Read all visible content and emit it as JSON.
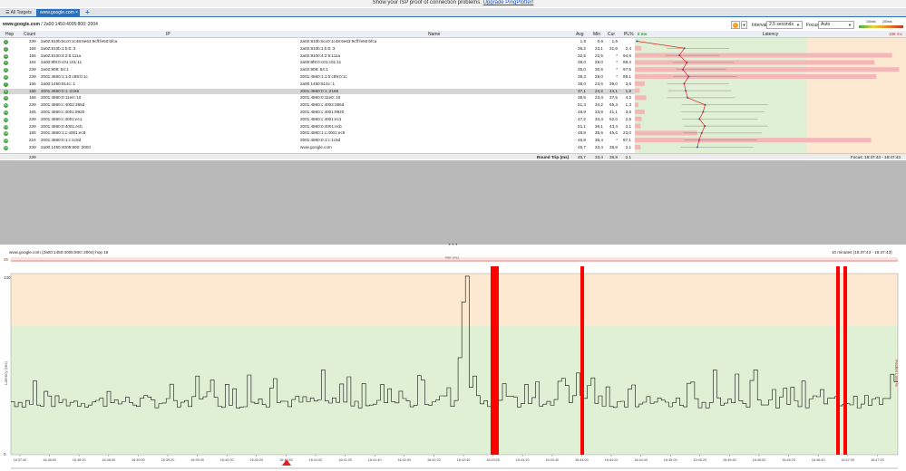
{
  "banner": {
    "text": "Show your ISP proof of connection problems.",
    "link": "Upgrade PingPlotter!"
  },
  "tabs": [
    {
      "label": "All Targets"
    },
    {
      "label": "www.google.com"
    }
  ],
  "tab_add": "+",
  "target": {
    "host": "www.google.com",
    "address": "2a00:1450:4005:800::2004"
  },
  "controls": {
    "interval_label": "Interval",
    "interval_value": "2.5 seconds",
    "focus_label": "Focus",
    "focus_value": "Auto",
    "scale_100": "100ms",
    "scale_200": "200ms"
  },
  "table": {
    "headers": {
      "hop": "Hop",
      "count": "Count",
      "ip": "IP",
      "name": "Name",
      "avg": "Avg",
      "min": "Min",
      "cur": "Cur",
      "pl": "PL%",
      "latency": "Latency"
    },
    "latency_min": "0 ms",
    "latency_max": "198 ms",
    "rows": [
      {
        "hop": "1",
        "count": "239",
        "ip": "2a02:810b:5cc0:1c48:6e63:9cff:fe50:bfca",
        "name": "2a02:810b:5cc0:1c48:6e63:9cff:fe50:bfca",
        "avg": "1,6",
        "min": "0,6",
        "cur": "1,5",
        "pl": ""
      },
      {
        "hop": "2",
        "count": "166",
        "ip": "2a02:810b:1:b:0::3",
        "name": "2a02:810b:1:b:0::3",
        "avg": "36,2",
        "min": "23,1",
        "cur": "31,8",
        "pl": "2,4"
      },
      {
        "hop": "3",
        "count": "156",
        "ip": "2a02:8100:4:2:6:111a",
        "name": "2a02:8100:4:2:6:111a",
        "avg": "32,5",
        "min": "22,5",
        "cur": "*",
        "pl": "94,9"
      },
      {
        "hop": "4",
        "count": "164",
        "ip": "2a00:8f8:0:c01:c01:11",
        "name": "2a00:8f8:0:c01:c01:11",
        "avg": "38,0",
        "min": "28,0",
        "cur": "*",
        "pl": "88,4"
      },
      {
        "hop": "5",
        "count": "239",
        "ip": "2a02:908::54:1",
        "name": "2a02:908::54:1",
        "avg": "35,0",
        "min": "30,5",
        "cur": "*",
        "pl": "97,5"
      },
      {
        "hop": "6",
        "count": "239",
        "ip": "2001:4860:1:1:0:c89:0:1c",
        "name": "2001:4860:1:1:0:c89:0:1c",
        "avg": "39,3",
        "min": "28,0",
        "cur": "*",
        "pl": "89,1"
      },
      {
        "hop": "7",
        "count": "166",
        "ip": "2a00:1450:814c::1",
        "name": "2a00:1450:814c::1",
        "avg": "36,0",
        "min": "23,5",
        "cur": "39,0",
        "pl": "3,6"
      },
      {
        "hop": "8",
        "count": "166",
        "ip": "2001:4860:0:1::2166",
        "name": "2001:4860:0:1::2166",
        "avg": "37,1",
        "min": "24,2",
        "cur": "44,1",
        "pl": "1,8"
      },
      {
        "hop": "9",
        "count": "166",
        "ip": "2001:4860:0:11e0::10",
        "name": "2001:4860:0:11e0::10",
        "avg": "38,5",
        "min": "23,4",
        "cur": "37,5",
        "pl": "4,2"
      },
      {
        "hop": "10",
        "count": "239",
        "ip": "2001:4860:c:4002:365d",
        "name": "2001:4860:c:4002:365d",
        "avg": "51,3",
        "min": "34,2",
        "cur": "65,3",
        "pl": "1,3"
      },
      {
        "hop": "11",
        "count": "165",
        "ip": "2001:4860:c:4001:9920",
        "name": "2001:4860:c:4001:9920",
        "avg": "49,9",
        "min": "33,9",
        "cur": "41,1",
        "pl": "3,6"
      },
      {
        "hop": "12",
        "count": "239",
        "ip": "2001:4860:c:4001:ec1",
        "name": "2001:4860:c:4001:ec1",
        "avg": "47,2",
        "min": "34,4",
        "cur": "52,0",
        "pl": "2,5"
      },
      {
        "hop": "13",
        "count": "239",
        "ip": "2001:4860:0:4001:ecb",
        "name": "2001:4860:0:4001:ecb",
        "avg": "51,1",
        "min": "36,1",
        "cur": "43,4",
        "pl": "2,1"
      },
      {
        "hop": "14",
        "count": "165",
        "ip": "2001:4860:1:c:4001:ec9",
        "name": "2001:4860:1:c:4001:ec9",
        "avg": "48,8",
        "min": "35,6",
        "cur": "45,6",
        "pl": "23,0"
      },
      {
        "hop": "15",
        "count": "224",
        "ip": "2001:4860:0:1:c:1c5d",
        "name": "2001:4860:0:1:c:1c5d",
        "avg": "46,9",
        "min": "36,4",
        "cur": "*",
        "pl": "87,1"
      },
      {
        "hop": "16",
        "count": "239",
        "ip": "2a00:1450:4005:800::2004",
        "name": "www.google.com",
        "avg": "45,7",
        "min": "33,4",
        "cur": "36,8",
        "pl": "2,1"
      }
    ],
    "footer": {
      "count": "239",
      "label": "Round Trip (ms)",
      "avg": "45,7",
      "min": "33,4",
      "cur": "36,8",
      "pl": "2,1",
      "focus": "Focus: 16:37:43 - 16:47:43"
    }
  },
  "splitter": "• • •",
  "bottom": {
    "title": "www.google.com (2a00:1450:4005:800::2004) hop 16",
    "range": "10 minutes (16:37:43 - 16:47:43)",
    "pl_value": "35",
    "y_top": "140",
    "y_zero": "0",
    "ylabel": "Latency (ms)",
    "ylabel_right": "Packet Loss %",
    "jitter_label": "Jitter (ms)",
    "xticks": [
      "16:37:40",
      "16:38:00",
      "16:38:20",
      "16:38:40",
      "16:39:00",
      "16:39:20",
      "16:39:40",
      "16:40:00",
      "16:40:20",
      "16:40:40",
      "16:41:00",
      "16:41:20",
      "16:41:40",
      "16:42:00",
      "16:42:20",
      "16:42:40",
      "16:43:00",
      "16:43:20",
      "16:43:40",
      "16:44:00",
      "16:44:20",
      "16:44:40",
      "16:45:00",
      "16:45:20",
      "16:45:40",
      "16:46:00",
      "16:46:20",
      "16:46:40",
      "16:47:00",
      "16:47:20"
    ]
  },
  "colors": {
    "accent": "#2b6fbf",
    "green_zone": "#dff0d4",
    "orange_zone": "#fde9d2",
    "loss": "#ff0000",
    "row_bar": "#f4b6b6"
  }
}
